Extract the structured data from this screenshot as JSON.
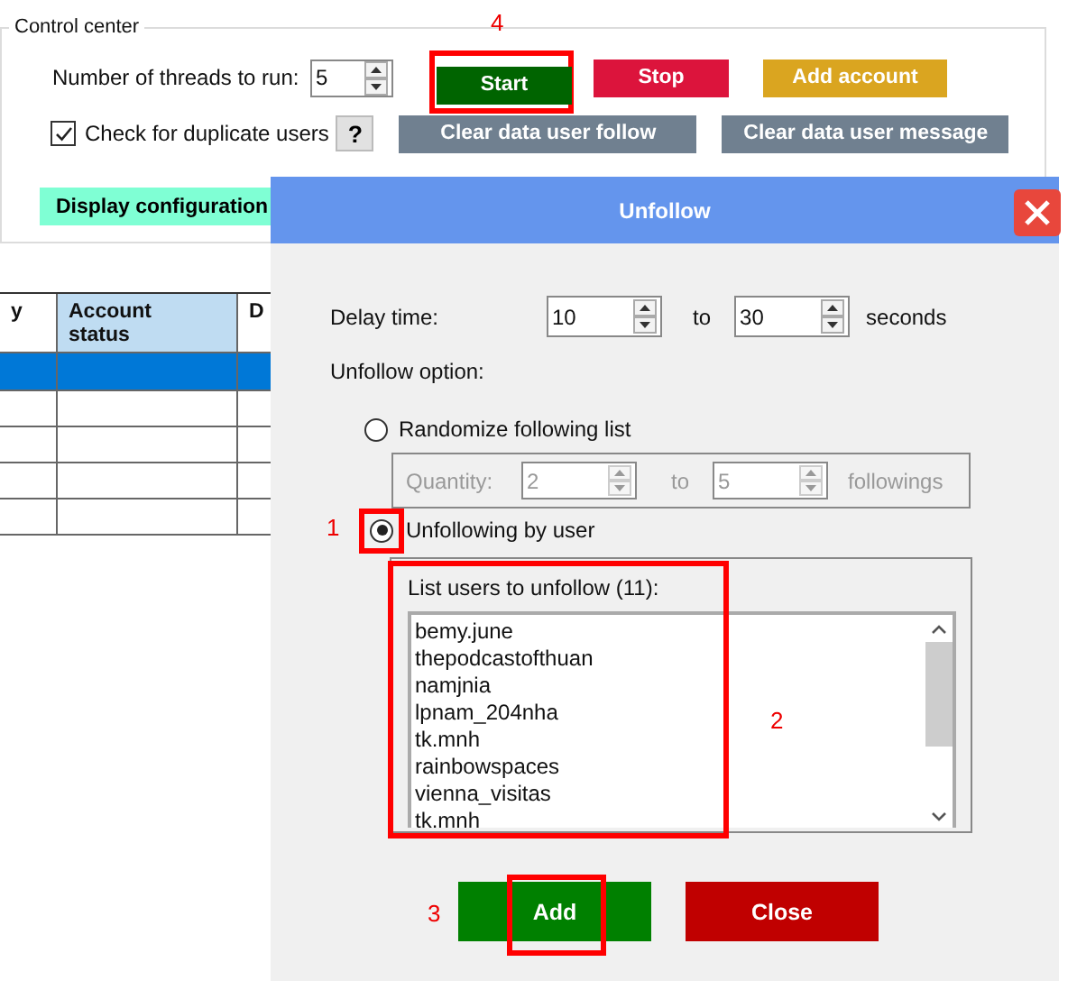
{
  "control_center": {
    "title": "Control center",
    "threads_label": "Number of threads to run:",
    "threads_value": "5",
    "buttons": [
      {
        "label": "Start",
        "kind": "start",
        "annotation": "4"
      },
      {
        "label": "Stop",
        "kind": "stop"
      },
      {
        "label": "Add account",
        "kind": "add"
      }
    ],
    "duplicate_check": {
      "label": "Check for duplicate users",
      "checked": true
    },
    "help_button": "?",
    "clear_buttons": [
      "Clear data user follow",
      "Clear data user message"
    ],
    "display_button": "Display configuration"
  },
  "table": {
    "columns": [
      "y",
      "Account status",
      "D"
    ],
    "rows": [
      {
        "selected": true
      },
      {
        "selected": false
      },
      {
        "selected": false
      },
      {
        "selected": false
      },
      {
        "selected": false
      }
    ]
  },
  "dialog": {
    "title": "Unfollow",
    "delay": {
      "label": "Delay time:",
      "from": "10",
      "to_label": "to",
      "to": "30",
      "unit": "seconds"
    },
    "option_label": "Unfollow option:",
    "options": [
      {
        "label": "Randomize following list",
        "selected": false
      },
      {
        "label": "Unfollowing by user",
        "selected": true,
        "annotation": "1"
      }
    ],
    "quantity": {
      "label": "Quantity:",
      "from": "2",
      "to_label": "to",
      "to": "5",
      "unit": "followings",
      "disabled": true
    },
    "user_list": {
      "label": "List users to unfollow (11):",
      "annotation": "2",
      "users": [
        "bemy.june",
        "thepodcastofthuan",
        "namjnia",
        "lpnam_204nha",
        "tk.mnh",
        "rainbowspaces",
        "vienna_visitas",
        "tk.mnh"
      ]
    },
    "buttons": [
      {
        "label": "Add",
        "kind": "add",
        "annotation": "3"
      },
      {
        "label": "Close",
        "kind": "close"
      }
    ]
  }
}
